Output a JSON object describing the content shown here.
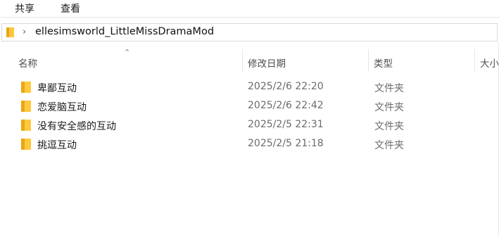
{
  "ribbon": {
    "tabs": [
      "共享",
      "查看"
    ]
  },
  "address": {
    "path": "ellesimsworld_LittleMissDramaMod",
    "chevron": "›"
  },
  "columns": {
    "name": "名称",
    "modified": "修改日期",
    "type": "类型",
    "size": "大小"
  },
  "files": [
    {
      "name": "卑鄙互动",
      "modified": "2025/2/6 22:20",
      "type": "文件夹"
    },
    {
      "name": "恋爱脑互动",
      "modified": "2025/2/6 22:42",
      "type": "文件夹"
    },
    {
      "name": "没有安全感的互动",
      "modified": "2025/2/5 22:31",
      "type": "文件夹"
    },
    {
      "name": "挑逗互动",
      "modified": "2025/2/5 21:18",
      "type": "文件夹"
    }
  ],
  "icons": {
    "folder": "folder-icon",
    "sort": "sort-ascending-icon",
    "chevron": "chevron-right-icon"
  },
  "colors": {
    "folder_yellow": "#ffc83d",
    "folder_dark": "#e8a812"
  }
}
